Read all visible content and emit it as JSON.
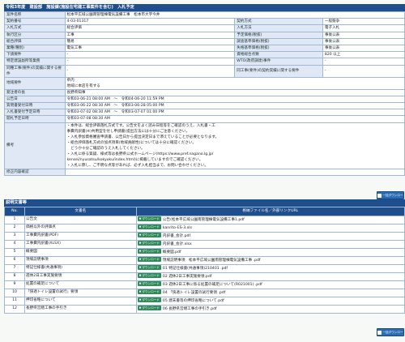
{
  "header": {
    "title": "令和3年度　建設部　施設課(施設在宅建工事案件を含む)　入札予定"
  },
  "info": {
    "rows": [
      {
        "l1": "案件名称",
        "v1": "松本平広域公園南管理棟電気設備工事　松本市大字今井",
        "span": true
      },
      {
        "l1": "契約番号",
        "v1": "4-03-01317",
        "l2": "契約方式",
        "v2": "一般競争"
      },
      {
        "l1": "入札方式",
        "v1": "総合評価",
        "l2": "入札方法",
        "v2": "電子入札"
      },
      {
        "l1": "執行区分",
        "v1": "工事",
        "l2": "予定価格(税抜)",
        "v2": "事後公表"
      },
      {
        "l1": "総合評価",
        "v1": "簡易",
        "l2": "調査基準価格(税抜)",
        "v2": "事後公表"
      },
      {
        "l1": "業種(種別)",
        "v1": "電気工事",
        "l2": "失格基準価格(税抜)",
        "v2": "事後公表"
      },
      {
        "l1": "下請要件",
        "v1": "-",
        "l2": "資格総合点数",
        "v2": "820 以上"
      },
      {
        "l1": "特定建設副所等業務",
        "v1": "-",
        "l2": "WTO(政府調達)事件",
        "v2": "-"
      },
      {
        "l1": "同種工事(要件)の実績に関する要件",
        "v1": "-",
        "l2": "同工事(要件)の契約実績に関する要件",
        "v2": "-"
      },
      {
        "l1": "地域要件",
        "v1": "県内\n地域に本店を有する",
        "span": true
      },
      {
        "l1": "発注者の長",
        "v1": "長野県知事",
        "span": true
      },
      {
        "l1": "公告日",
        "v1": "令和03-06-21 08:00 AM　〜　令和04-06-20 11:59 PM",
        "span": true
      },
      {
        "l1": "質問書受付日時",
        "v1": "令和03-06-22 08:30 AM　〜　令和03-06-28 05:00 PM",
        "span": true
      },
      {
        "l1": "入札書受付予定日時",
        "v1": "令和03-07-02 08:30 AM　〜　令和03-07-07 01:00 PM",
        "span": true
      },
      {
        "l1": "開札予定日時",
        "v1": "令和03-07-08 08:30 AM",
        "span": true
      }
    ],
    "remarks_label": "備考",
    "remarks": [
      "・本件は、総合評価落札方式です。公告文をよく読み日程等をご確認のうえ、入札書・工",
      "事費内訳書(※)共用型を付し申請書(提出方法には十分にご注意ください。",
      "・入札参加資格審査申請書、公告日から提出決定日まで添えていることが必要となります。",
      "・総合評価落札方式の加点項目(地域貢献性)については十分に確認ください。",
      "　どうか十分ご確認のうえ入札してください。",
      "・入札に係る質疑、様式等は長野県公式ホームページ(https://www.pref.nagano.lg.jp/",
      "kensei/nyusatsu/kokyoku/index.html)に掲載していますのでご確認ください。",
      "・入札に際し、ご不明な点等があれば、必ず入札担当まで、お問い合わせください。"
    ],
    "revision_label": "修正内容確認",
    "revision_value": ""
  },
  "quick_button": "一括ダウンロード",
  "docs": {
    "section_title": "説明文書等",
    "headers": {
      "no": "No.",
      "name": "文書名",
      "file": "格納ファイル名／外部リンクURL"
    },
    "download_label": "ダウンロード",
    "rows": [
      {
        "no": "1",
        "name": "公告文",
        "file": "公告(松本平広域公園南管理棟電気設備工事1.pdf"
      },
      {
        "no": "2",
        "name": "価格以外の評価点",
        "file": "kanrito-ES-3.xls"
      },
      {
        "no": "3",
        "name": "工事費内訳書(PDF)",
        "file": "内訳書_会計.pdf"
      },
      {
        "no": "4",
        "name": "工事費内訳書(XLSX)",
        "file": "内訳書_会計.xlsx"
      },
      {
        "no": "5",
        "name": "概要図",
        "file": "概要図.pdf"
      },
      {
        "no": "6",
        "name": "現場説明事項",
        "file": "現場説明事項　松本平広域公園南管理棟電気設備工事 .pdf"
      },
      {
        "no": "7",
        "name": "特記仕様書(共通事項)",
        "file": "01 特記仕様書(共通事項)210401 .pdf"
      },
      {
        "no": "8",
        "name": "週休2日工事実施要領",
        "file": "02 週休2日工事実施要領.pdf"
      },
      {
        "no": "9",
        "name": "処置の補足について",
        "file": "03 週休2日工事に係る処置の補足について(R021001) .pdf"
      },
      {
        "no": "10",
        "name": "「快適トイレ設置の試行」要領",
        "file": "04 「快適トイレ設置の試行要領 .pdf"
      },
      {
        "no": "11",
        "name": "押印省略について",
        "file": "05 建末書等の押印省略について.pdf"
      },
      {
        "no": "12",
        "name": "長野県営繕工事の手引き",
        "file": "06 長野県営繕工事の手引き.pdf"
      }
    ]
  }
}
